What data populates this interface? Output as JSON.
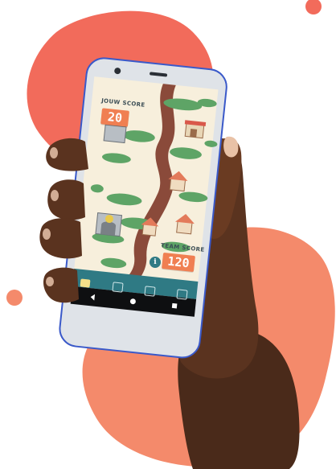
{
  "colors": {
    "blob_primary": "#f26b5b",
    "blob_secondary": "#f48a6b",
    "accent_dot": "#f26b5b",
    "phone_frame": "#dfe3e8",
    "phone_edge": "#3a59c9",
    "game_background": "#f7efdc",
    "game_tab_bar": "#2f7a84",
    "score_box": "#f07f52",
    "tree_path": "#8a4a3a",
    "foliage": "#5ea466"
  },
  "game": {
    "your_score_label": "JOUW SCORE",
    "your_score_value": "20",
    "team_score_label": "TEAM SCORE",
    "team_score_value": "120",
    "info_icon": "info-icon",
    "tabs": [
      {
        "icon": "map-icon"
      },
      {
        "icon": "profile-icon"
      },
      {
        "icon": "badge-icon"
      },
      {
        "icon": "news-icon"
      }
    ],
    "nav_buttons": [
      "back-icon",
      "home-icon",
      "recents-icon"
    ]
  }
}
